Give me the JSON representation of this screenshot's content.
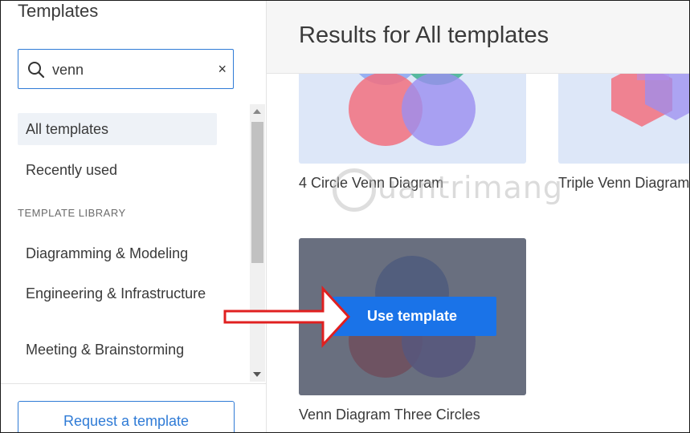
{
  "sidebar": {
    "title": "Templates",
    "search": {
      "value": "venn",
      "clear_icon": "×"
    },
    "nav": {
      "all_templates": "All templates",
      "recently_used": "Recently used",
      "section_label": "TEMPLATE LIBRARY",
      "items": [
        "Diagramming & Modeling",
        "Engineering & Infrastructure",
        "Meeting & Brainstorming"
      ]
    },
    "request_button": "Request a template"
  },
  "main": {
    "title": "Results for All templates",
    "cards": [
      {
        "title": "4 Circle Venn Diagram"
      },
      {
        "title": "Triple Venn Diagram"
      },
      {
        "title": "Venn Diagram Three Circles",
        "use_button": "Use template"
      }
    ]
  },
  "watermark": "uantrimang",
  "colors": {
    "accent": "#1a73e8",
    "thumb_bg": "#dde7f8",
    "pink": "#f2707f",
    "purple": "#9b8ef0",
    "teal": "#3fb08f",
    "arrow": "#e02020"
  }
}
